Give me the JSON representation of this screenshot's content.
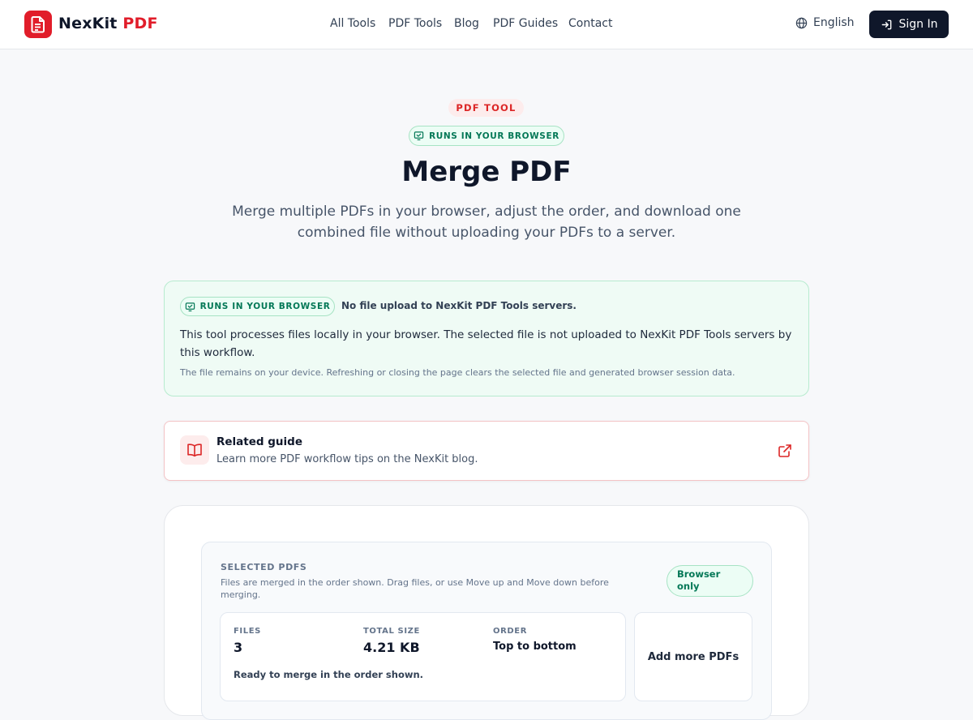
{
  "header": {
    "brand_main": "NexKit",
    "brand_accent": "PDF",
    "nav": [
      "All Tools",
      "PDF Tools",
      "Blog",
      "PDF Guides",
      "Contact"
    ],
    "language": "English",
    "sign_in": "Sign In"
  },
  "hero": {
    "eyebrow": "PDF TOOL",
    "browser_badge": "RUNS IN YOUR BROWSER",
    "title": "Merge PDF",
    "description": "Merge multiple PDFs in your browser, adjust the order, and download one combined file without uploading your PDFs to a server."
  },
  "notice": {
    "badge": "RUNS IN YOUR BROWSER",
    "headline": "No file upload to NexKit PDF Tools servers.",
    "body": "This tool processes files locally in your browser. The selected file is not uploaded to NexKit PDF Tools servers by this workflow.",
    "small": "The file remains on your device. Refreshing or closing the page clears the selected file and generated browser session data."
  },
  "guide": {
    "title": "Related guide",
    "subtitle": "Learn more PDF workflow tips on the NexKit blog."
  },
  "selected": {
    "title": "SELECTED PDFS",
    "description": "Files are merged in the order shown. Drag files, or use Move up and Move down before merging.",
    "badge": "Browser only",
    "stats": [
      {
        "label": "FILES",
        "value": "3"
      },
      {
        "label": "TOTAL SIZE",
        "value": "4.21 KB"
      },
      {
        "label": "ORDER",
        "value": "Top to bottom"
      }
    ],
    "status": "Ready to merge in the order shown.",
    "add_more": "Add more PDFs"
  },
  "colors": {
    "accent": "#e11d2a",
    "dark": "#0f172a",
    "success": "#047857"
  }
}
